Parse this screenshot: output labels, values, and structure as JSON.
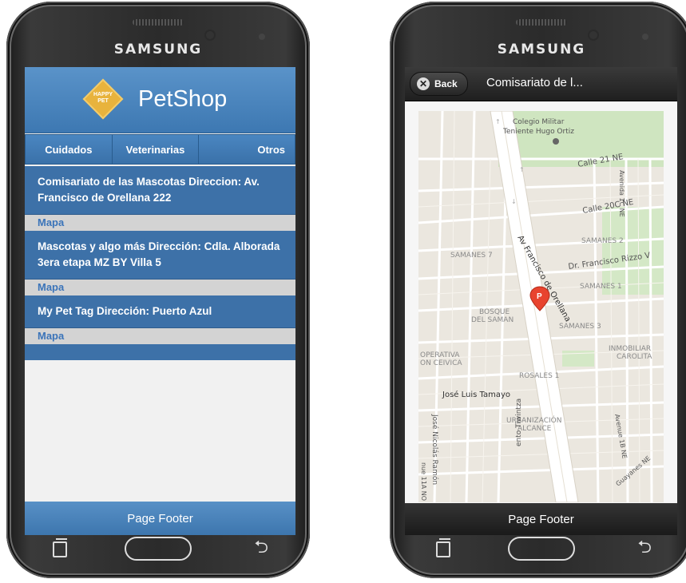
{
  "left_phone": {
    "brand": "SAMSUNG",
    "logo_text_line1": "HAPPY",
    "logo_text_line2": "PET",
    "app_title": "PetShop",
    "tabs": [
      {
        "label": "Cuidados"
      },
      {
        "label": "Veterinarias"
      },
      {
        "label": "Otros"
      }
    ],
    "items": [
      {
        "text": "Comisariato de las Mascotas Direccion: Av. Francisco de Orellana 222",
        "link": "Mapa"
      },
      {
        "text": "Mascotas y algo más Dirección: Cdla. Alborada 3era etapa MZ BY Villa 5",
        "link": "Mapa"
      },
      {
        "text": "My Pet Tag Dirección: Puerto Azul",
        "link": "Mapa"
      }
    ],
    "footer": "Page Footer"
  },
  "right_phone": {
    "brand": "SAMSUNG",
    "back_label": "Back",
    "title": "Comisariato de l...",
    "footer": "Page Footer",
    "map_labels": {
      "colegio1": "Colegio Militar",
      "colegio2": "Teniente Hugo Ortiz",
      "calle21": "Calle 21 NE",
      "calle20c": "Calle 20C NE",
      "avenida": "Avenida 1C NE",
      "samanes7": "SAMANES 7",
      "samanes2": "SAMANES 2",
      "rizzo": "Dr. Francisco Rizzo V",
      "avfrancisco": "Av Francisco de Orellana",
      "samanes1": "SAMANES 1",
      "bosque1": "BOSQUE",
      "bosque2": "DEL SAMAN",
      "samanes3": "SAMANES 3",
      "operativa1": "OPERATIVA",
      "operativa2": "ON CEIVICA",
      "inmob1": "INMOBILIAR",
      "inmob2": "CAROLITA",
      "rosales": "ROSALES 1",
      "tamayo": "José Luis Tamayo",
      "urban1": "URBANIZACIÓN",
      "urban2": "ALCANCE",
      "avenue1b": "Avenue 1B NE",
      "nicolas": "José Nicolás Ramón",
      "tiwintza": "ento Tiwintza",
      "nue11": "nue 11A NO",
      "guayanes": "Guayanes NE",
      "pin": "P"
    }
  },
  "colors": {
    "header_blue": "#4a86c1",
    "list_blue": "#3d71a8",
    "link_blue": "#3b74b9",
    "dark_bar": "#262626",
    "pin_red": "#e8432e"
  }
}
